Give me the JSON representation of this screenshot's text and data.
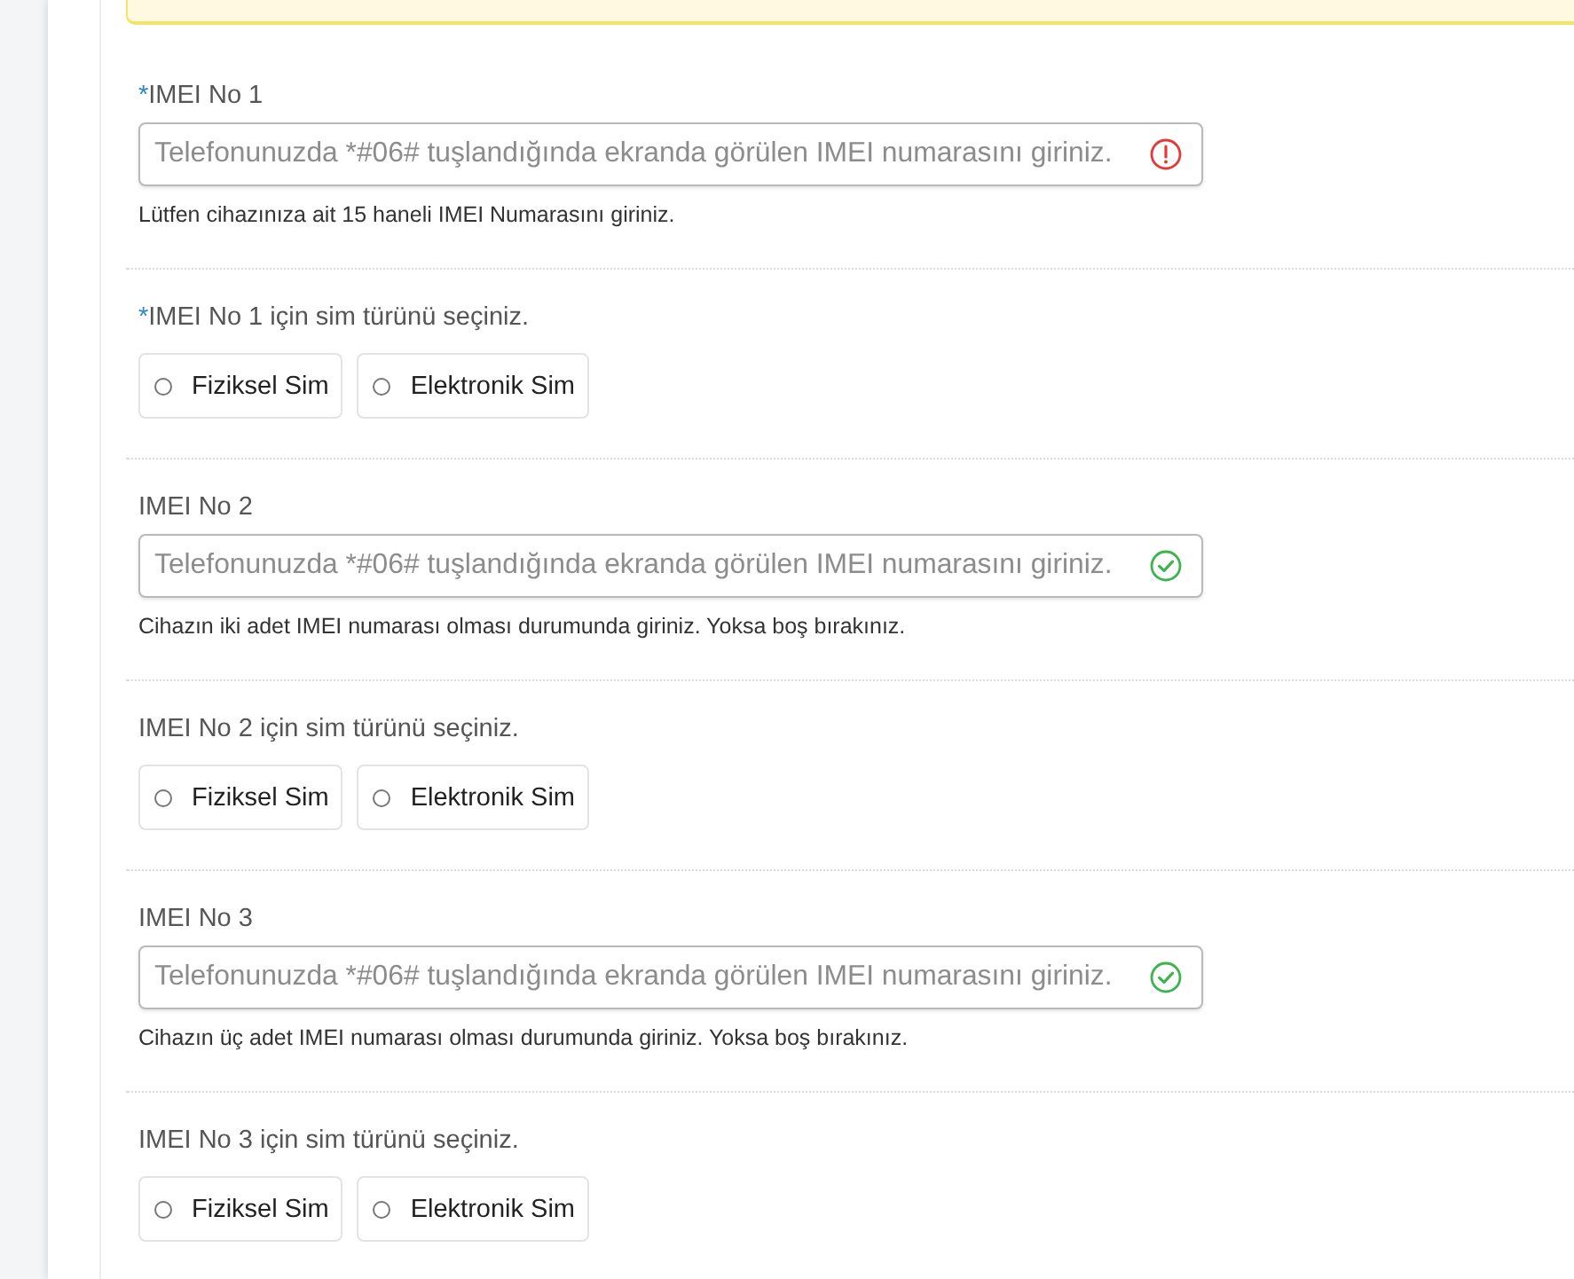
{
  "fields": [
    {
      "kind": "imei",
      "required_mark": "*",
      "label": "IMEI No 1",
      "placeholder": "Telefonunuzda *#06# tuşlandığında ekranda görülen IMEI numarasını giriniz.",
      "valid": false,
      "help": "Lütfen cihazınıza ait 15 haneli IMEI Numarasını giriniz."
    },
    {
      "kind": "sim_type",
      "required_mark": "*",
      "label": "IMEI No 1 için sim türünü seçiniz.",
      "options": [
        {
          "label": "Fiziksel Sim",
          "selected": false
        },
        {
          "label": "Elektronik Sim",
          "selected": false
        }
      ]
    },
    {
      "kind": "imei",
      "label": "IMEI No 2",
      "placeholder": "Telefonunuzda *#06# tuşlandığında ekranda görülen IMEI numarasını giriniz.",
      "valid": true,
      "help": "Cihazın iki adet IMEI numarası olması durumunda giriniz. Yoksa boş bırakınız."
    },
    {
      "kind": "sim_type",
      "label": "IMEI No 2 için sim türünü seçiniz.",
      "options": [
        {
          "label": "Fiziksel Sim",
          "selected": false
        },
        {
          "label": "Elektronik Sim",
          "selected": false
        }
      ]
    },
    {
      "kind": "imei",
      "label": "IMEI No 3",
      "placeholder": "Telefonunuzda *#06# tuşlandığında ekranda görülen IMEI numarasını giriniz.",
      "valid": true,
      "help": "Cihazın üç adet IMEI numarası olması durumunda giriniz. Yoksa boş bırakınız."
    },
    {
      "kind": "sim_type",
      "label": "IMEI No 3 için sim türünü seçiniz.",
      "options": [
        {
          "label": "Fiziksel Sim",
          "selected": false
        },
        {
          "label": "Elektronik Sim",
          "selected": false
        }
      ]
    }
  ]
}
